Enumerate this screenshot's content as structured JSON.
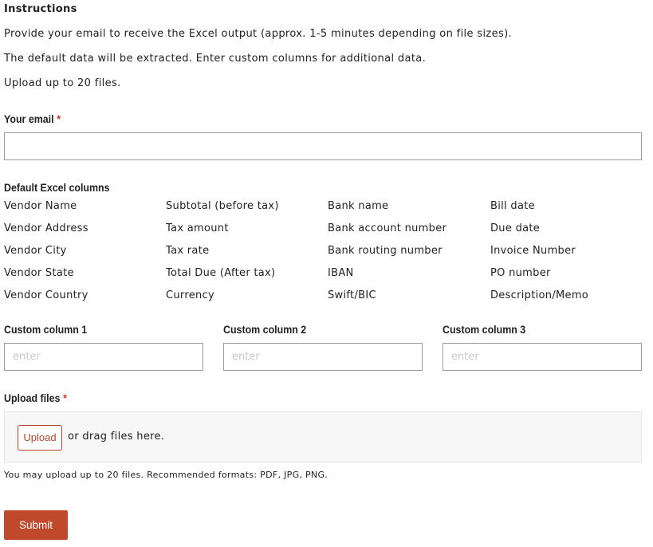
{
  "instructions": {
    "title": "Instructions",
    "lines": [
      "Provide your email to receive the Excel output (approx. 1-5 minutes depending on file sizes).",
      "The default data will be extracted. Enter custom columns for additional data.",
      "Upload up to 20 files."
    ]
  },
  "email": {
    "label": "Your email",
    "required_mark": "*",
    "value": ""
  },
  "default_columns": {
    "label": "Default Excel columns",
    "columns": [
      [
        "Vendor Name",
        "Vendor Address",
        "Vendor City",
        "Vendor State",
        "Vendor Country"
      ],
      [
        "Subtotal (before tax)",
        "Tax amount",
        "Tax rate",
        "Total Due (After tax)",
        "Currency"
      ],
      [
        "Bank name",
        "Bank account number",
        "Bank routing number",
        "IBAN",
        "Swift/BIC"
      ],
      [
        "Bill date",
        "Due date",
        "Invoice Number",
        "PO number",
        "Description/Memo"
      ]
    ]
  },
  "custom_columns": [
    {
      "label": "Custom column 1",
      "placeholder": "enter",
      "value": ""
    },
    {
      "label": "Custom column 2",
      "placeholder": "enter",
      "value": ""
    },
    {
      "label": "Custom column 3",
      "placeholder": "enter",
      "value": ""
    }
  ],
  "upload": {
    "label": "Upload files",
    "required_mark": "*",
    "button_label": "Upload",
    "drag_hint": "or drag files here.",
    "help_text": "You may upload up to 20 files. Recommended formats: PDF, JPG, PNG."
  },
  "submit": {
    "label": "Submit"
  },
  "colors": {
    "accent": "#c0492b",
    "required": "#c0392b",
    "text": "#222222",
    "input_border": "#9a9a9a",
    "upload_bg": "#f7f7f7"
  }
}
